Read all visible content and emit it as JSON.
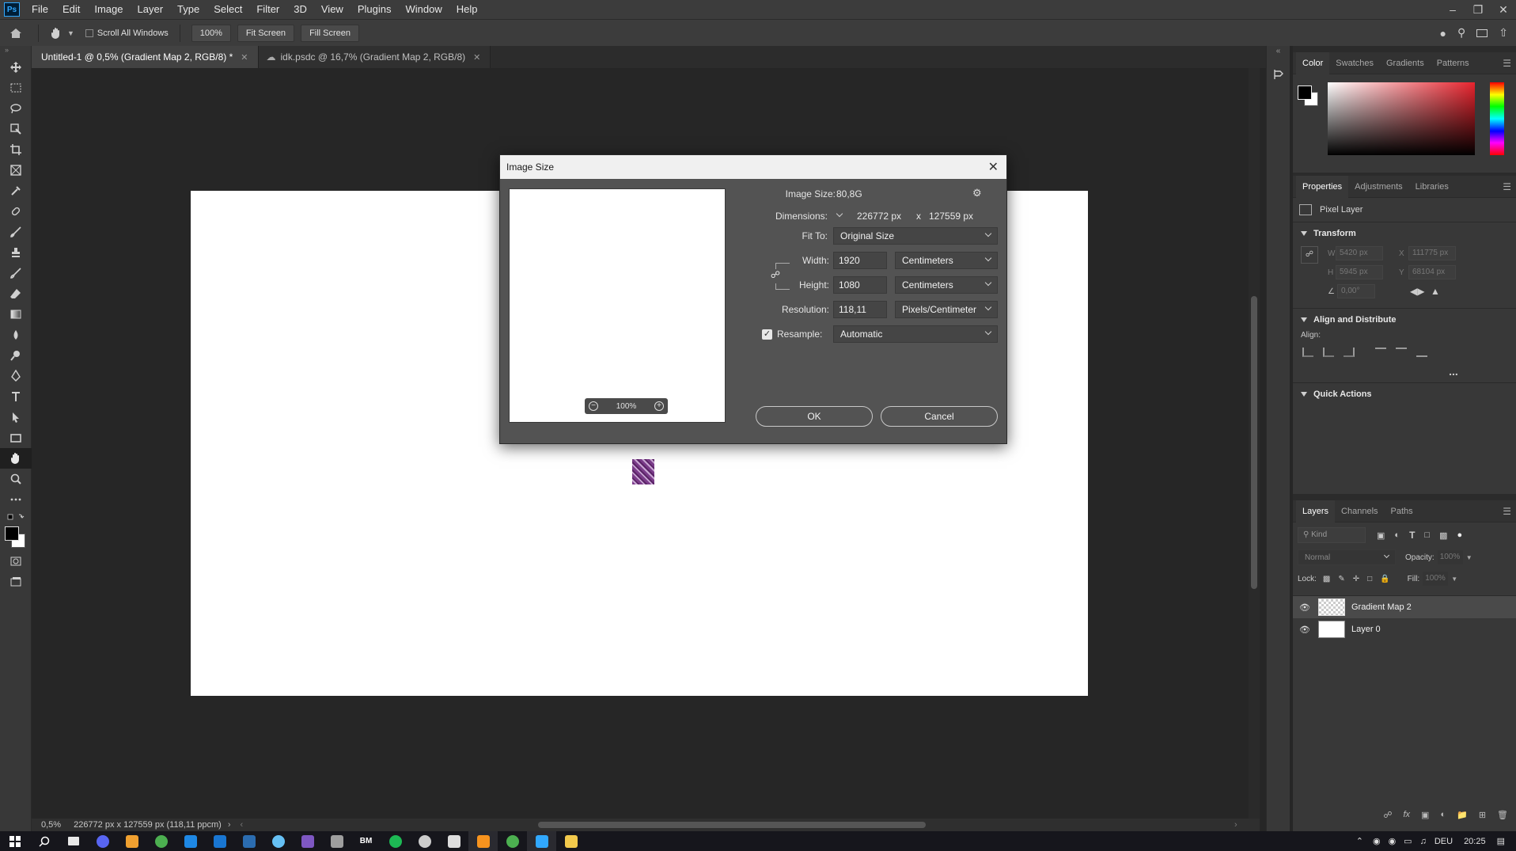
{
  "app": {
    "logo": "Ps"
  },
  "menu": [
    "File",
    "Edit",
    "Image",
    "Layer",
    "Type",
    "Select",
    "Filter",
    "3D",
    "View",
    "Plugins",
    "Window",
    "Help"
  ],
  "options": {
    "scroll_all": "Scroll All Windows",
    "zoom": "100%",
    "fit_screen": "Fit Screen",
    "fill_screen": "Fill Screen"
  },
  "tabs": [
    {
      "label": "Untitled-1 @ 0,5% (Gradient Map 2, RGB/8) *"
    },
    {
      "label": "idk.psdc @ 16,7% (Gradient Map 2, RGB/8)"
    }
  ],
  "status": {
    "zoom": "0,5%",
    "info": "226772 px x 127559 px (118,11 ppcm)"
  },
  "dialog": {
    "title": "Image Size",
    "image_size_label": "Image Size:",
    "image_size_value": "80,8G",
    "dimensions_label": "Dimensions:",
    "dim_w": "226772 px",
    "dim_x": "x",
    "dim_h": "127559 px",
    "fit_to_label": "Fit To:",
    "fit_to_value": "Original Size",
    "width_label": "Width:",
    "width_value": "1920",
    "width_unit": "Centimeters",
    "height_label": "Height:",
    "height_value": "1080",
    "height_unit": "Centimeters",
    "resolution_label": "Resolution:",
    "resolution_value": "118,11",
    "resolution_unit": "Pixels/Centimeter",
    "resample_label": "Resample:",
    "resample_value": "Automatic",
    "resample_checked": true,
    "preview_zoom": "100%",
    "ok": "OK",
    "cancel": "Cancel"
  },
  "color_panel": {
    "tabs": [
      "Color",
      "Swatches",
      "Gradients",
      "Patterns"
    ]
  },
  "properties_panel": {
    "tabs": [
      "Properties",
      "Adjustments",
      "Libraries"
    ],
    "layer_type": "Pixel Layer",
    "transform": "Transform",
    "w": "W",
    "w_value": "5420 px",
    "h": "H",
    "h_value": "5945 px",
    "x": "X",
    "x_value": "111775 px",
    "y": "Y",
    "y_value": "68104 px",
    "angle_value": "0,00°",
    "align_distribute": "Align and Distribute",
    "align": "Align:",
    "more": "...",
    "quick_actions": "Quick Actions"
  },
  "layers_panel": {
    "tabs": [
      "Layers",
      "Channels",
      "Paths"
    ],
    "kind_placeholder": "Kind",
    "blend_mode": "Normal",
    "opacity_label": "Opacity:",
    "opacity_value": "100%",
    "lock_label": "Lock:",
    "fill_label": "Fill:",
    "fill_value": "100%",
    "layers": [
      {
        "name": "Gradient Map 2",
        "selected": true
      },
      {
        "name": "Layer 0",
        "selected": false
      }
    ]
  },
  "taskbar": {
    "lang": "DEU",
    "time": "20:25",
    "bm_label": "BM",
    "icon_colors": [
      "#2d7cd6",
      "#e8e8e8",
      "#5865f2",
      "#f0a030",
      "#4caf50",
      "#1e88e5",
      "#1976d2",
      "#2b6cb0",
      "#66c0f4",
      "#7e57c2",
      "#9e9e9e",
      "#ffffff",
      "#1db954",
      "#cccccc",
      "#dddddd",
      "#f7931e",
      "#4caf50",
      "#31a8ff",
      "#f2c94c"
    ]
  }
}
